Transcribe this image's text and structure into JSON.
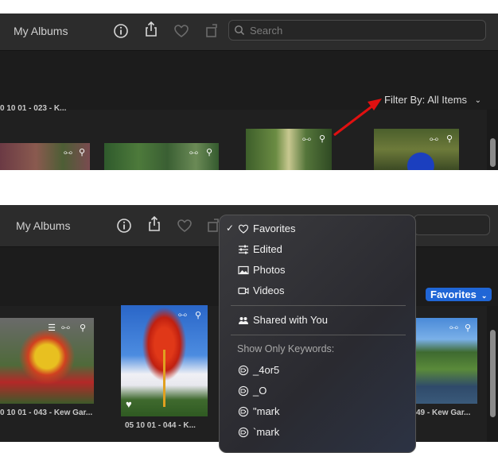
{
  "top": {
    "title": "My Albums",
    "search_placeholder": "Search",
    "filter_prefix": "Filter By:",
    "filter_value": "All Items",
    "clipped_caption": "0 10 01 - 023 - K..."
  },
  "bottom": {
    "title": "My Albums",
    "favorites_pill": "Favorites",
    "captions": [
      "0 10 01 - 043 - Kew Gar...",
      "05 10 01 - 044 - K...",
      "49 - Kew Gar..."
    ]
  },
  "menu": {
    "items": [
      {
        "label": "Favorites",
        "checked": true,
        "icon": "heart-icon"
      },
      {
        "label": "Edited",
        "checked": false,
        "icon": "sliders-icon"
      },
      {
        "label": "Photos",
        "checked": false,
        "icon": "photo-icon"
      },
      {
        "label": "Videos",
        "checked": false,
        "icon": "video-icon"
      },
      {
        "label": "Shared with You",
        "checked": false,
        "icon": "shared-people-icon"
      }
    ],
    "keywords_header": "Show Only Keywords:",
    "keywords": [
      "_4or5",
      "_O",
      "\"mark",
      "`mark"
    ]
  },
  "colors": {
    "accent": "#2066d6",
    "annotation_arrow": "#e01010",
    "background": "#202020"
  }
}
